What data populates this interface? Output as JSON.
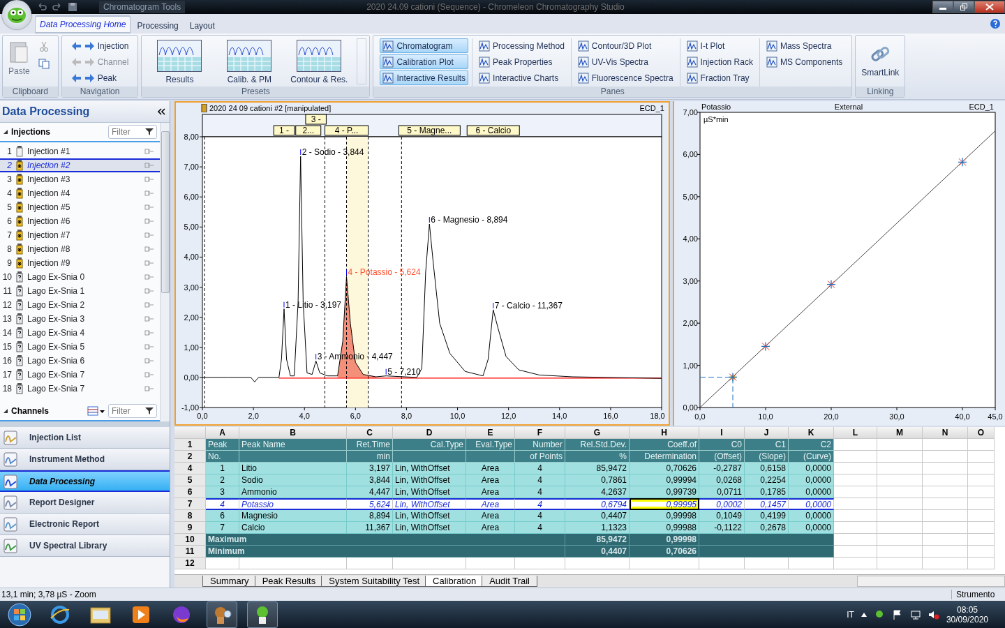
{
  "window": {
    "title": "2020 24.09 cationi (Sequence) - Chromeleon Chromatography Studio",
    "context_title": "Chromatogram Tools"
  },
  "ribbon": {
    "tabs": [
      {
        "label": "Data Processing Home",
        "selected": true
      },
      {
        "label": "Processing",
        "selected": false
      },
      {
        "label": "Layout",
        "selected": false
      }
    ],
    "groups": [
      {
        "kind": "clipboard",
        "title": "Clipboard",
        "items": [
          {
            "label": "Paste",
            "disabled": true
          }
        ]
      },
      {
        "kind": "navigation",
        "title": "Navigation",
        "items": [
          {
            "label": "Injection",
            "disabled": false
          },
          {
            "label": "Channel",
            "disabled": true
          },
          {
            "label": "Peak",
            "disabled": false
          }
        ]
      },
      {
        "kind": "presets",
        "title": "Presets",
        "items": [
          {
            "label": "Results"
          },
          {
            "label": "Calib. & PM"
          },
          {
            "label": "Contour & Res."
          }
        ]
      },
      {
        "kind": "panes",
        "title": "Panes",
        "columns": [
          [
            {
              "label": "Chromatogram",
              "on": true
            },
            {
              "label": "Calibration Plot",
              "on": true
            },
            {
              "label": "Interactive Results",
              "on": true
            }
          ],
          [
            {
              "label": "Processing Method",
              "on": false
            },
            {
              "label": "Peak Properties",
              "on": false
            },
            {
              "label": "Interactive Charts",
              "on": false
            }
          ],
          [
            {
              "label": "Contour/3D Plot",
              "on": false
            },
            {
              "label": "UV-Vis Spectra",
              "on": false
            },
            {
              "label": "Fluorescence Spectra",
              "on": false
            }
          ],
          [
            {
              "label": "I-t Plot",
              "on": false
            },
            {
              "label": "Injection Rack",
              "on": false
            },
            {
              "label": "Fraction Tray",
              "on": false
            }
          ],
          [
            {
              "label": "Mass Spectra",
              "on": false
            },
            {
              "label": "MS Components",
              "on": false
            }
          ]
        ]
      },
      {
        "kind": "linking",
        "title": "Linking",
        "items": [
          {
            "label": "SmartLink"
          }
        ]
      }
    ]
  },
  "sidebar": {
    "title": "Data Processing",
    "injections": {
      "title": "Injections",
      "filter_placeholder": "Filter",
      "items": [
        {
          "number": "1",
          "name": "Injection #1",
          "kind": "blank",
          "selected": false
        },
        {
          "number": "2",
          "name": "Injection #2",
          "kind": "standard",
          "selected": true
        },
        {
          "number": "3",
          "name": "Injection #3",
          "kind": "standard",
          "selected": false
        },
        {
          "number": "4",
          "name": "Injection #4",
          "kind": "standard",
          "selected": false
        },
        {
          "number": "5",
          "name": "Injection #5",
          "kind": "standard",
          "selected": false
        },
        {
          "number": "6",
          "name": "Injection #6",
          "kind": "standard",
          "selected": false
        },
        {
          "number": "7",
          "name": "Injection #7",
          "kind": "standard",
          "selected": false
        },
        {
          "number": "8",
          "name": "Injection #8",
          "kind": "standard",
          "selected": false
        },
        {
          "number": "9",
          "name": "Injection #9",
          "kind": "standard",
          "selected": false
        },
        {
          "number": "10",
          "name": "Lago Ex-Snia 0",
          "kind": "unknown",
          "selected": false
        },
        {
          "number": "11",
          "name": "Lago Ex-Snia 1",
          "kind": "unknown",
          "selected": false
        },
        {
          "number": "12",
          "name": "Lago Ex-Snia 2",
          "kind": "unknown",
          "selected": false
        },
        {
          "number": "13",
          "name": "Lago Ex-Snia 3",
          "kind": "unknown",
          "selected": false
        },
        {
          "number": "14",
          "name": "Lago Ex-Snia 4",
          "kind": "unknown",
          "selected": false
        },
        {
          "number": "15",
          "name": "Lago Ex-Snia 5",
          "kind": "unknown",
          "selected": false
        },
        {
          "number": "16",
          "name": "Lago Ex-Snia 6",
          "kind": "unknown",
          "selected": false
        },
        {
          "number": "17",
          "name": "Lago Ex-Snia 7",
          "kind": "unknown",
          "selected": false
        },
        {
          "number": "18",
          "name": "Lago Ex-Snia 7",
          "kind": "unknown",
          "selected": false
        }
      ]
    },
    "channels": {
      "title": "Channels",
      "filter_placeholder": "Filter"
    },
    "nav": [
      {
        "label": "Injection List",
        "selected": false
      },
      {
        "label": "Instrument Method",
        "selected": false
      },
      {
        "label": "Data Processing",
        "selected": true
      },
      {
        "label": "Report Designer",
        "selected": false
      },
      {
        "label": "Electronic Report",
        "selected": false
      },
      {
        "label": "UV Spectral Library",
        "selected": false
      }
    ]
  },
  "chromatogram": {
    "title": "2020 24 09 cationi #2 [manipulated]",
    "channel": "ECD_1",
    "peak_windows": [
      {
        "label": "1 -",
        "raised": false
      },
      {
        "label": "2...",
        "raised": false
      },
      {
        "label": "3 -",
        "raised": true
      },
      {
        "label": "4 - P...",
        "raised": false
      },
      {
        "label": "5 - Magne...",
        "raised": false
      },
      {
        "label": "6 - Calcio",
        "raised": false
      }
    ],
    "peaks": [
      {
        "label": "2 - Sodio - 3,844",
        "selected": false
      },
      {
        "label": "6 - Magnesio - 8,894",
        "selected": false
      },
      {
        "label": "4 - Potassio - 5,624",
        "selected": true
      },
      {
        "label": "1 - Litio - 3,197",
        "selected": false
      },
      {
        "label": "7 - Calcio - 11,367",
        "selected": false
      },
      {
        "label": "3 - Ammonio - 4,447",
        "selected": false
      },
      {
        "label": "5 - 7,210",
        "selected": false
      }
    ],
    "chart_data": {
      "type": "line",
      "xlim": [
        0,
        18
      ],
      "ylim": [
        -1,
        8
      ],
      "xticks": [
        {
          "value": 0,
          "label": "0,0"
        },
        {
          "value": 2,
          "label": "2,0"
        },
        {
          "value": 4,
          "label": "4,0"
        },
        {
          "value": 6,
          "label": "6,0"
        },
        {
          "value": 8,
          "label": "8,0"
        },
        {
          "value": 10,
          "label": "10,0"
        },
        {
          "value": 12,
          "label": "12,0"
        },
        {
          "value": 14,
          "label": "14,0"
        },
        {
          "value": 16,
          "label": "16,0"
        },
        {
          "value": 18,
          "label": "18,0"
        }
      ],
      "yticks": [
        {
          "value": -1,
          "label": "-1,00"
        },
        {
          "value": 0,
          "label": "0,00"
        },
        {
          "value": 1,
          "label": "1,00"
        },
        {
          "value": 2,
          "label": "2,00"
        },
        {
          "value": 3,
          "label": "3,00"
        },
        {
          "value": 4,
          "label": "4,00"
        },
        {
          "value": 5,
          "label": "5,00"
        },
        {
          "value": 6,
          "label": "6,00"
        },
        {
          "value": 7,
          "label": "7,00"
        },
        {
          "value": 8,
          "label": "8,00"
        }
      ],
      "x": [
        0,
        1.0,
        1.9,
        2.05,
        2.2,
        3.0,
        3.1,
        3.2,
        3.3,
        3.45,
        3.6,
        3.75,
        3.85,
        3.95,
        4.1,
        4.3,
        4.45,
        4.6,
        4.9,
        5.3,
        5.5,
        5.65,
        5.8,
        6.0,
        6.3,
        6.8,
        7.2,
        8.4,
        8.6,
        8.75,
        8.9,
        9.05,
        9.3,
        9.7,
        10.3,
        11.0,
        11.2,
        11.4,
        11.6,
        11.9,
        12.4,
        13.2,
        14.5,
        18.0
      ],
      "series": [
        {
          "color": "#000000",
          "values": [
            0,
            0,
            0,
            -0.15,
            0,
            0,
            0.6,
            2.28,
            0.6,
            0.05,
            0.05,
            2.5,
            7.35,
            2.5,
            0.15,
            0.1,
            0.55,
            0.15,
            0.05,
            0.05,
            1.2,
            3.35,
            1.8,
            0.5,
            0.1,
            0.02,
            0.05,
            0,
            0.3,
            3.5,
            5.1,
            3.8,
            1.8,
            0.8,
            0.2,
            0.05,
            0.6,
            2.25,
            1.6,
            0.7,
            0.25,
            0.08,
            0.02,
            -0.03
          ]
        }
      ],
      "ref_lines": [
        {
          "axis": "y",
          "value": 0,
          "color": "#ff0000"
        }
      ]
    }
  },
  "calibration": {
    "method": "External",
    "channel": "ECD_1",
    "chart_data": {
      "type": "scatter",
      "title": "Potassio",
      "ylabel": "µS*min",
      "xlim": [
        0,
        45
      ],
      "ylim": [
        0,
        7
      ],
      "xticks": [
        {
          "value": 0,
          "label": "0,0"
        },
        {
          "value": 10,
          "label": "10,0"
        },
        {
          "value": 20,
          "label": "20,0"
        },
        {
          "value": 30,
          "label": "30,0"
        },
        {
          "value": 40,
          "label": "40,0"
        },
        {
          "value": 45,
          "label": "45,0"
        }
      ],
      "yticks": [
        {
          "value": 0,
          "label": "0,00"
        },
        {
          "value": 1,
          "label": "1,00"
        },
        {
          "value": 2,
          "label": "2,00"
        },
        {
          "value": 3,
          "label": "3,00"
        },
        {
          "value": 4,
          "label": "4,00"
        },
        {
          "value": 5,
          "label": "5,00"
        },
        {
          "value": 6,
          "label": "6,00"
        },
        {
          "value": 7,
          "label": "7,00"
        }
      ],
      "x": [
        0,
        5,
        10,
        20,
        40,
        45
      ],
      "series": [
        {
          "color": "#1f6fc0",
          "values": [
            null,
            0.72,
            1.45,
            2.92,
            5.82,
            null
          ]
        },
        {
          "type": "line",
          "color": "#444444",
          "values": [
            0,
            null,
            1.46,
            2.91,
            5.83,
            6.56
          ]
        }
      ]
    }
  },
  "table": {
    "columns": [
      "A",
      "B",
      "C",
      "D",
      "E",
      "F",
      "G",
      "H",
      "I",
      "J",
      "K",
      "L",
      "M",
      "N",
      "O"
    ],
    "header_rows": [
      {
        "number": "1",
        "cells": [
          "Peak",
          "Peak Name",
          "Ret.Time",
          "Cal.Type",
          "Eval.Type",
          "Number",
          "Rel.Std.Dev.",
          "Coeff.of",
          "C0",
          "C1",
          "C2"
        ]
      },
      {
        "number": "2",
        "cells": [
          "No.",
          null,
          "min",
          null,
          null,
          "of Points",
          "%",
          "Determination",
          "(Offset)",
          "(Slope)",
          "(Curve)"
        ]
      }
    ],
    "rows": [
      {
        "number": "4",
        "selected": false,
        "coeff_cell_focused": false,
        "cells": [
          "1",
          "Litio",
          "3,197",
          "Lin, WithOffset",
          "Area",
          "4",
          "85,9472",
          "0,70626",
          "-0,2787",
          "0,6158",
          "0,0000"
        ]
      },
      {
        "number": "5",
        "selected": false,
        "coeff_cell_focused": false,
        "cells": [
          "2",
          "Sodio",
          "3,844",
          "Lin, WithOffset",
          "Area",
          "4",
          "0,7861",
          "0,99994",
          "0,0268",
          "0,2254",
          "0,0000"
        ]
      },
      {
        "number": "6",
        "selected": false,
        "coeff_cell_focused": false,
        "cells": [
          "3",
          "Ammonio",
          "4,447",
          "Lin, WithOffset",
          "Area",
          "4",
          "4,2637",
          "0,99739",
          "0,0711",
          "0,1785",
          "0,0000"
        ]
      },
      {
        "number": "7",
        "selected": true,
        "coeff_cell_focused": true,
        "cells": [
          "4",
          "Potassio",
          "5,624",
          "Lin, WithOffset",
          "Area",
          "4",
          "0,6794",
          "0,99995",
          "0,0002",
          "0,1457",
          "0,0000"
        ]
      },
      {
        "number": "8",
        "selected": false,
        "coeff_cell_focused": false,
        "cells": [
          "6",
          "Magnesio",
          "8,894",
          "Lin, WithOffset",
          "Area",
          "4",
          "0,4407",
          "0,99998",
          "0,1049",
          "0,4199",
          "0,0000"
        ]
      },
      {
        "number": "9",
        "selected": false,
        "coeff_cell_focused": false,
        "cells": [
          "7",
          "Calcio",
          "11,367",
          "Lin, WithOffset",
          "Area",
          "4",
          "1,1323",
          "0,99988",
          "-0,1122",
          "0,2678",
          "0,0000"
        ]
      }
    ],
    "summary_rows": [
      {
        "number": "10",
        "label": "Maximum",
        "rel_std_dev": "85,9472",
        "coeff": "0,99998"
      },
      {
        "number": "11",
        "label": "Minimum",
        "rel_std_dev": "0,4407",
        "coeff": "0,70626"
      }
    ],
    "empty_rows": [
      "12"
    ],
    "sheets": [
      {
        "label": "Summary",
        "selected": false
      },
      {
        "label": "Peak Results",
        "selected": false
      },
      {
        "label": "System Suitability Test",
        "selected": false
      },
      {
        "label": "Calibration",
        "selected": true
      },
      {
        "label": "Audit Trail",
        "selected": false
      }
    ]
  },
  "status_bar": {
    "message": "13,1 min; 3,78 µS - Zoom",
    "mode": "Strumento"
  },
  "taskbar": {
    "language": "IT",
    "time": "08:05",
    "date": "30/09/2020"
  }
}
